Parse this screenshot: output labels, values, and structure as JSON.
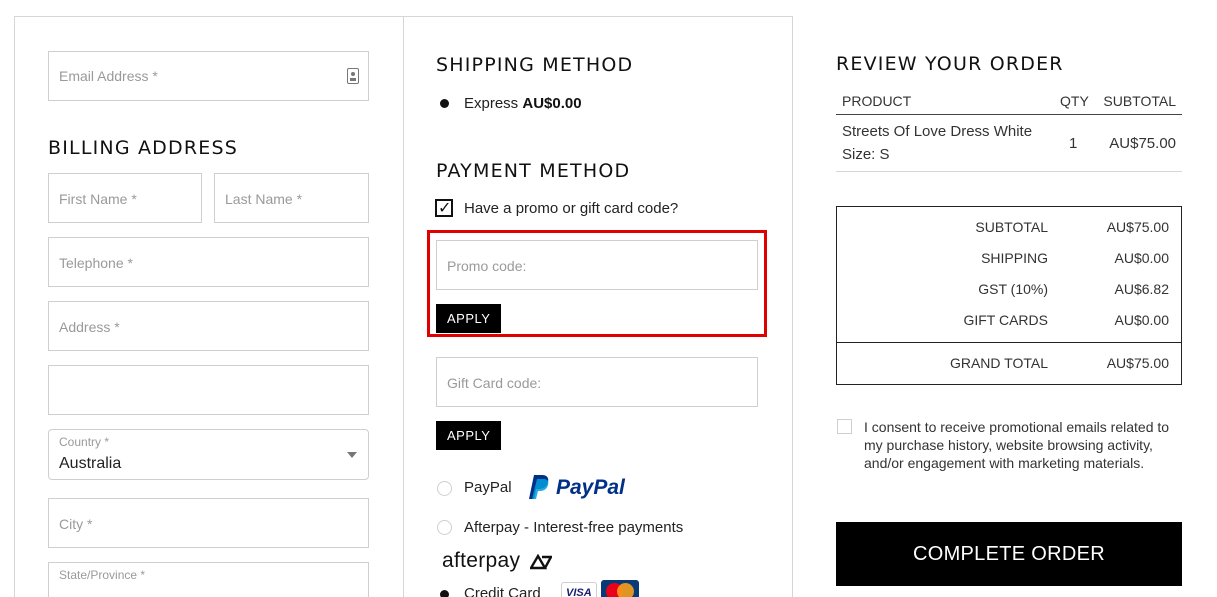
{
  "billing": {
    "email_placeholder": "Email Address *",
    "title": "BILLING ADDRESS",
    "first_name_placeholder": "First Name *",
    "last_name_placeholder": "Last Name *",
    "telephone_placeholder": "Telephone *",
    "address_placeholder": "Address *",
    "address2_value": "",
    "country_label": "Country *",
    "country_value": "Australia",
    "city_placeholder": "City *",
    "state_label": "State/Province *"
  },
  "shipping": {
    "title": "SHIPPING METHOD",
    "option_label": "Express",
    "option_price": "AU$0.00"
  },
  "payment": {
    "title": "PAYMENT METHOD",
    "promo_checkbox_label": "Have a promo or gift card code?",
    "promo_checkbox_mark": "✓",
    "promo_placeholder": "Promo code:",
    "apply_label": "APPLY",
    "gift_placeholder": "Gift Card code:",
    "gift_apply_label": "APPLY",
    "paypal_label": "PayPal",
    "paypal_logo": "PayPal",
    "afterpay_label": "Afterpay - Interest-free payments",
    "afterpay_logo": "afterpay",
    "credit_card_label": "Credit Card",
    "visa_logo": "VISA"
  },
  "review": {
    "title": "REVIEW YOUR ORDER",
    "headers": {
      "product": "PRODUCT",
      "qty": "QTY",
      "subtotal": "SUBTOTAL"
    },
    "item": {
      "name": "Streets Of Love Dress White",
      "size": "Size: S",
      "qty": "1",
      "subtotal": "AU$75.00"
    },
    "totals": {
      "subtotal_label": "SUBTOTAL",
      "subtotal_value": "AU$75.00",
      "shipping_label": "SHIPPING",
      "shipping_value": "AU$0.00",
      "gst_label": "GST (10%)",
      "gst_value": "AU$6.82",
      "gift_label": "GIFT CARDS",
      "gift_value": "AU$0.00",
      "grand_label": "GRAND TOTAL",
      "grand_value": "AU$75.00"
    },
    "consent_text": "I consent to receive promotional emails related to my purchase history, website browsing activity, and/or engagement with marketing materials.",
    "complete_label": "COMPLETE ORDER"
  },
  "colors": {
    "highlight": "#e00000",
    "paypal_dark": "#003087",
    "paypal_light": "#009cde"
  }
}
